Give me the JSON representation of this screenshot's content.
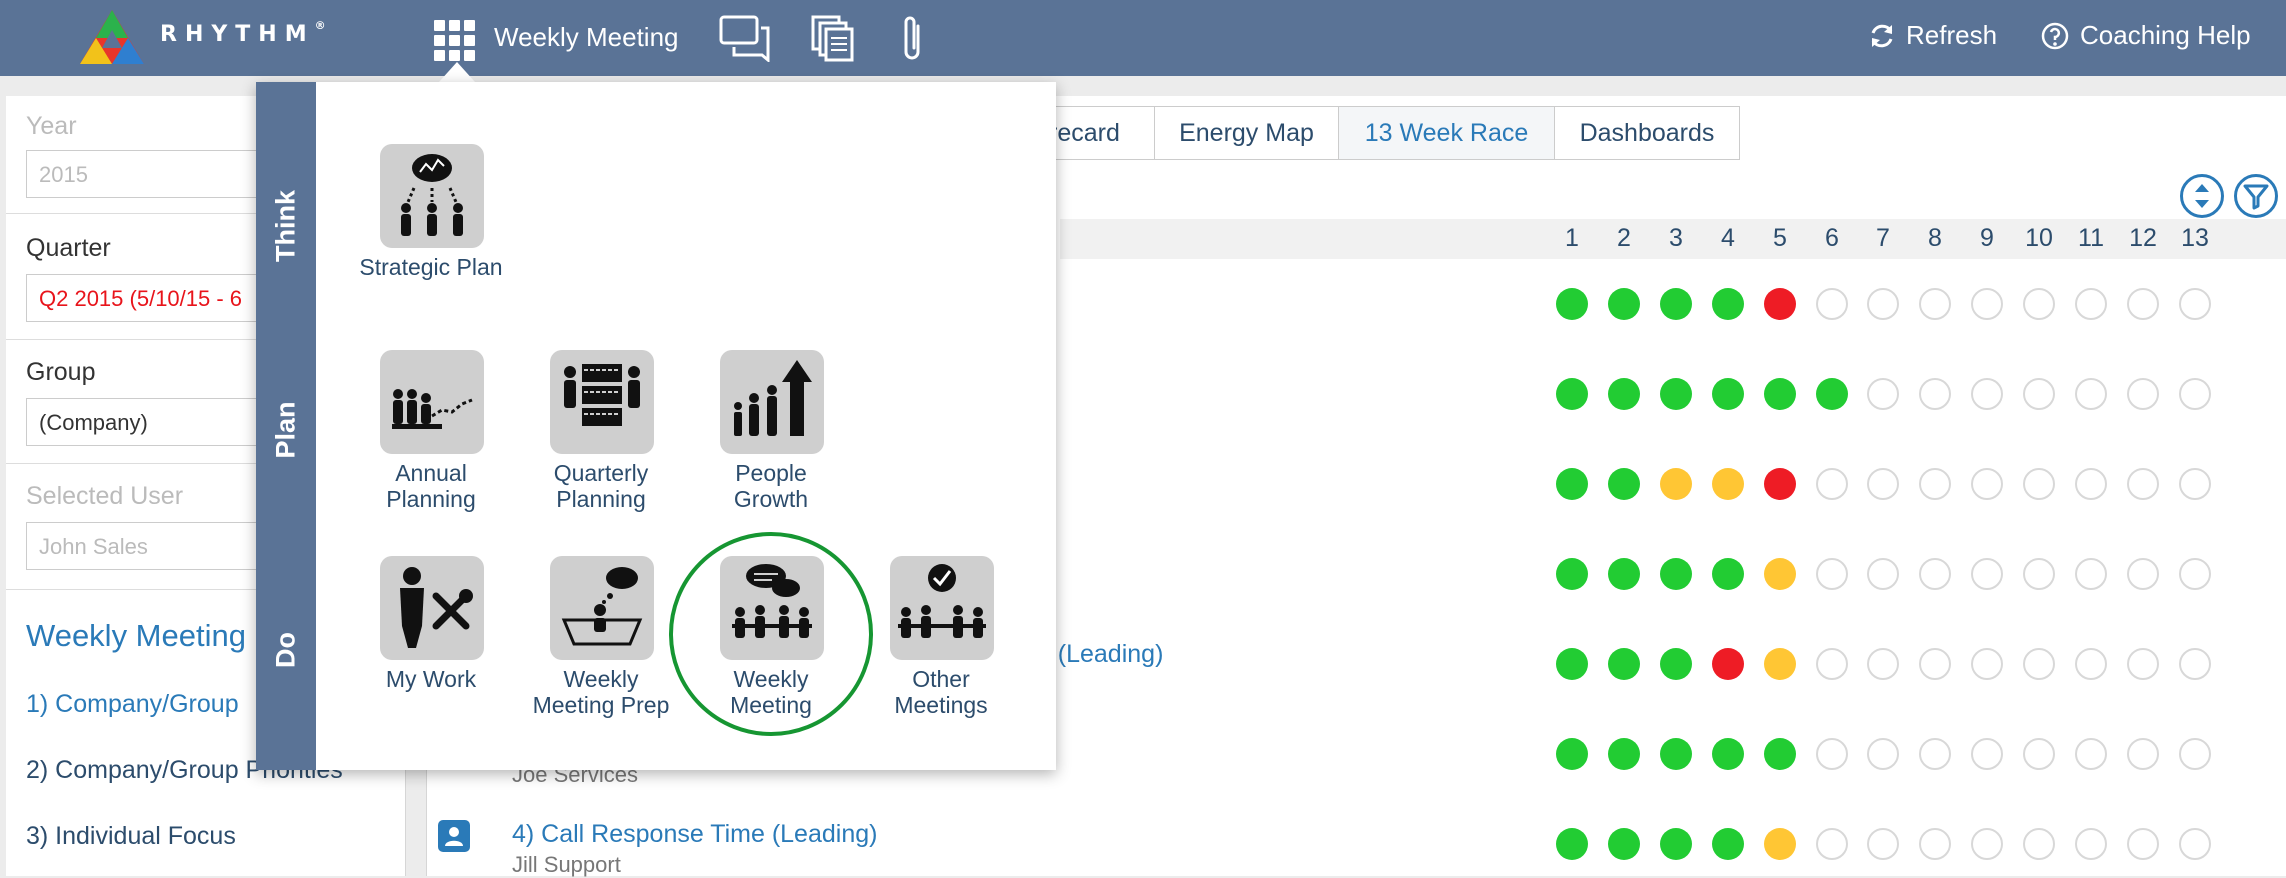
{
  "topbar": {
    "brand": "RHYTHM",
    "brand_mark": "®",
    "menu_title": "Weekly Meeting",
    "refresh_label": "Refresh",
    "help_label": "Coaching Help"
  },
  "left": {
    "year_label": "Year",
    "year_value": "2015",
    "quarter_label": "Quarter",
    "quarter_value": "Q2 2015 (5/10/15 - 6",
    "group_label": "Group",
    "group_value": "(Company)",
    "user_label": "Selected User",
    "user_value": "John Sales",
    "nav_heading": "Weekly Meeting",
    "nav_items": [
      "1) Company/Group",
      "2) Company/Group Priorities",
      "3) Individual Focus"
    ]
  },
  "tabs": [
    "orecard",
    "Energy Map",
    "13 Week Race",
    "Dashboards"
  ],
  "weeks": [
    "1",
    "2",
    "3",
    "4",
    "5",
    "6",
    "7",
    "8",
    "9",
    "10",
    "11",
    "12",
    "13"
  ],
  "kpis": [
    {
      "title": "",
      "owner": ""
    },
    {
      "title": "",
      "owner": ""
    },
    {
      "title": "",
      "owner": ""
    },
    {
      "title": "",
      "owner": ""
    },
    {
      "title": "m (Leading)",
      "owner": ""
    },
    {
      "title": "",
      "owner": "Joe Services"
    },
    {
      "title": "4) Call Response Time (Leading)",
      "owner": "Jill Support"
    }
  ],
  "status_rows": [
    [
      "g",
      "g",
      "g",
      "g",
      "r",
      "e",
      "e",
      "e",
      "e",
      "e",
      "e",
      "e",
      "e"
    ],
    [
      "g",
      "g",
      "g",
      "g",
      "g",
      "g",
      "e",
      "e",
      "e",
      "e",
      "e",
      "e",
      "e"
    ],
    [
      "g",
      "g",
      "y",
      "y",
      "r",
      "e",
      "e",
      "e",
      "e",
      "e",
      "e",
      "e",
      "e"
    ],
    [
      "g",
      "g",
      "g",
      "g",
      "y",
      "e",
      "e",
      "e",
      "e",
      "e",
      "e",
      "e",
      "e"
    ],
    [
      "g",
      "g",
      "g",
      "r",
      "y",
      "e",
      "e",
      "e",
      "e",
      "e",
      "e",
      "e",
      "e"
    ],
    [
      "g",
      "g",
      "g",
      "g",
      "g",
      "e",
      "e",
      "e",
      "e",
      "e",
      "e",
      "e",
      "e"
    ],
    [
      "g",
      "g",
      "g",
      "g",
      "y",
      "e",
      "e",
      "e",
      "e",
      "e",
      "e",
      "e",
      "e"
    ]
  ],
  "menu": {
    "sections": [
      "Think",
      "Plan",
      "Do"
    ],
    "items": {
      "strategic_plan": "Strategic Plan",
      "annual_planning": "Annual Planning",
      "quarterly_planning": "Quarterly Planning",
      "people_growth": "People Growth",
      "my_work": "My Work",
      "weekly_meeting_prep": "Weekly Meeting Prep",
      "weekly_meeting": "Weekly Meeting",
      "other_meetings": "Other Meetings"
    }
  },
  "colors": {
    "topbar": "#5a7396",
    "link": "#2a7ab8",
    "status_green": "#22cc33",
    "status_red": "#ee1c25",
    "status_yellow": "#ffc634",
    "highlight": "#169632"
  },
  "icons": [
    "rhythm-logo",
    "apps-grid-icon",
    "chat-icon",
    "documents-icon",
    "paperclip-icon",
    "refresh-icon",
    "help-icon",
    "sort-icon",
    "filter-icon",
    "user-icon"
  ]
}
